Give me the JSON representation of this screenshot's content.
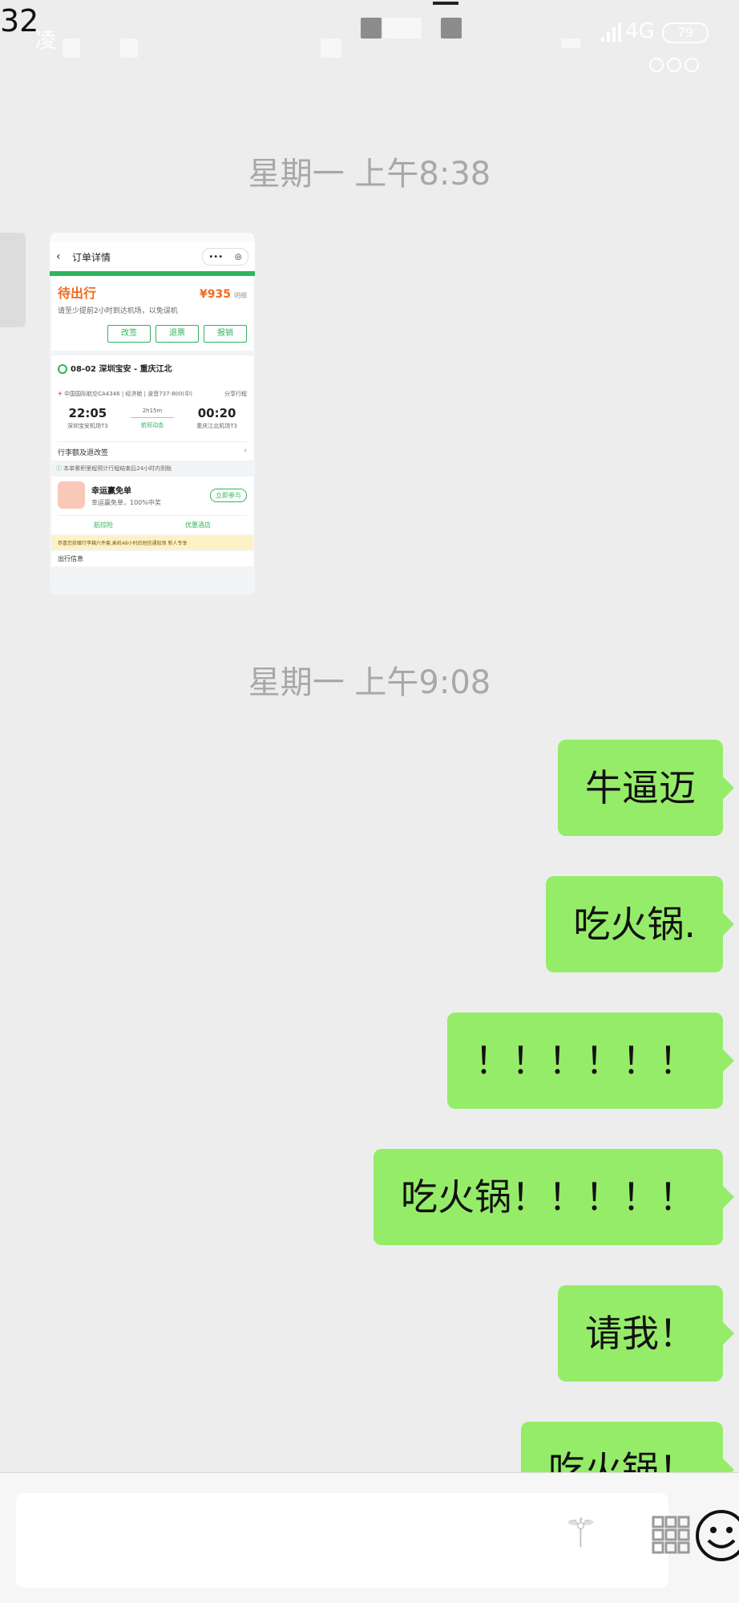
{
  "status_bar": {
    "time": "32",
    "carrier": "凌",
    "network": "4G",
    "battery": "79"
  },
  "messages": [
    {
      "timestamp": "星期一 上午8:38"
    },
    {
      "image": {
        "nav_title": "订单详情",
        "status": "待出行",
        "price": "¥935",
        "price_detail": "明细",
        "hint": "请至少提前2小时到达机场，以免误机",
        "buttons": [
          "改签",
          "退票",
          "报销"
        ],
        "route": "08-02 深圳宝安 - 重庆江北",
        "airline": "中国国际航空CA4346 | 经济舱 | 波音737-800(中)",
        "share": "分享行程",
        "depart_time": "22:05",
        "depart_airport": "深圳宝安机场T3",
        "duration": "2h15m",
        "flight_status": "航班动态",
        "arrive_time": "00:20",
        "arrive_airport": "重庆江北机场T3",
        "baggage": "行李额及退改签",
        "note": "本单累积里程预计行程结束后24小时内到账",
        "lucky_title": "幸运赢免单",
        "lucky_sub": "幸运赢免单，100%中奖",
        "join": "立即参与",
        "link1": "航综险",
        "link2": "优惠酒店",
        "tip": "恭喜您获赠行李箱六件套,乘机48小时后短信通知领",
        "tip_extra": "新人专享",
        "more": "出行信息"
      }
    },
    {
      "timestamp": "星期一 上午9:08"
    },
    {
      "text": "牛逼迈"
    },
    {
      "text": "吃火锅."
    },
    {
      "text": "！！！！！！"
    },
    {
      "text": "吃火锅！！！！！"
    },
    {
      "text": "请我！"
    },
    {
      "text": "吃火锅！"
    }
  ],
  "colors": {
    "bubble": "#95ec69",
    "background": "#ededed",
    "accent": "#2fb45c"
  },
  "icons": [
    "magic-wand-icon",
    "keypad-icon",
    "emoji-icon",
    "more-icon"
  ]
}
